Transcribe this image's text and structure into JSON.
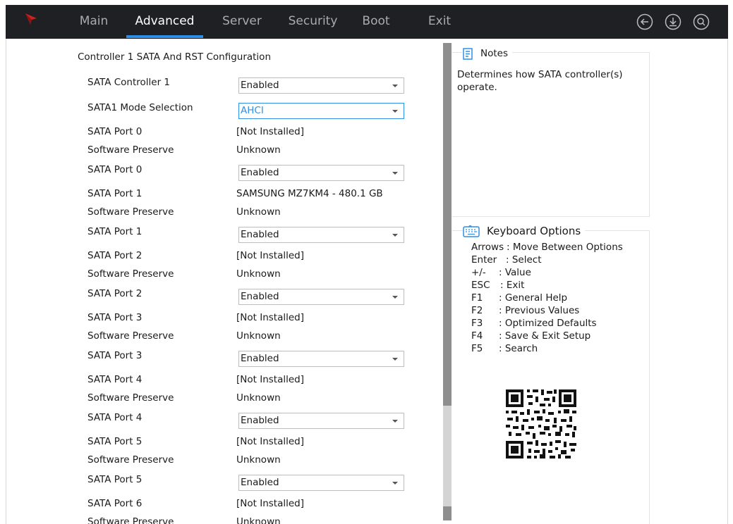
{
  "nav": {
    "tabs": [
      {
        "label": "Main"
      },
      {
        "label": "Advanced"
      },
      {
        "label": "Server"
      },
      {
        "label": "Security"
      },
      {
        "label": "Boot"
      },
      {
        "label": "Exit"
      }
    ],
    "active_tab": "Advanced",
    "icons": [
      "back-icon",
      "download-icon",
      "search-icon"
    ],
    "accent_color": "#2f8fe6"
  },
  "main": {
    "section_title": "Controller 1 SATA And RST Configuration",
    "rows": [
      {
        "label": "SATA Controller 1",
        "value": "Enabled",
        "kind": "select"
      },
      {
        "label": "SATA1 Mode Selection",
        "value": "AHCI",
        "kind": "select",
        "focused": true
      },
      {
        "label": "SATA Port 0",
        "value": "[Not Installed]",
        "kind": "text"
      },
      {
        "label": "Software Preserve",
        "value": "Unknown",
        "kind": "text"
      },
      {
        "label": "SATA Port 0",
        "value": "Enabled",
        "kind": "select"
      },
      {
        "label": "SATA Port 1",
        "value": "SAMSUNG MZ7KM4 - 480.1 GB",
        "kind": "text"
      },
      {
        "label": "Software Preserve",
        "value": "Unknown",
        "kind": "text"
      },
      {
        "label": "SATA Port 1",
        "value": "Enabled",
        "kind": "select"
      },
      {
        "label": "SATA Port 2",
        "value": "[Not Installed]",
        "kind": "text"
      },
      {
        "label": "Software Preserve",
        "value": "Unknown",
        "kind": "text"
      },
      {
        "label": "SATA Port 2",
        "value": "Enabled",
        "kind": "select"
      },
      {
        "label": "SATA Port 3",
        "value": "[Not Installed]",
        "kind": "text"
      },
      {
        "label": "Software Preserve",
        "value": "Unknown",
        "kind": "text"
      },
      {
        "label": "SATA Port 3",
        "value": "Enabled",
        "kind": "select"
      },
      {
        "label": "SATA Port 4",
        "value": "[Not Installed]",
        "kind": "text"
      },
      {
        "label": "Software Preserve",
        "value": "Unknown",
        "kind": "text"
      },
      {
        "label": "SATA Port 4",
        "value": "Enabled",
        "kind": "select"
      },
      {
        "label": "SATA Port 5",
        "value": "[Not Installed]",
        "kind": "text"
      },
      {
        "label": "Software Preserve",
        "value": "Unknown",
        "kind": "text"
      },
      {
        "label": "SATA Port 5",
        "value": "Enabled",
        "kind": "select"
      },
      {
        "label": "SATA Port 6",
        "value": "[Not Installed]",
        "kind": "text"
      },
      {
        "label": "Software Preserve",
        "value": "Unknown",
        "kind": "text"
      }
    ]
  },
  "notes": {
    "title": "Notes",
    "text": "Determines how SATA controller(s) operate."
  },
  "keyboard": {
    "title": "Keyboard Options",
    "items": [
      {
        "key": "Arrows",
        "desc": ": Move Between Options"
      },
      {
        "key": "Enter",
        "desc": ": Select"
      },
      {
        "key": "+/-",
        "desc": ": Value"
      },
      {
        "key": "ESC",
        "desc": ": Exit"
      },
      {
        "key": "F1",
        "desc": ": General Help"
      },
      {
        "key": "F2",
        "desc": ": Previous Values"
      },
      {
        "key": "F3",
        "desc": ": Optimized Defaults"
      },
      {
        "key": "F4",
        "desc": ": Save & Exit Setup"
      },
      {
        "key": "F5",
        "desc": ": Search"
      }
    ]
  }
}
